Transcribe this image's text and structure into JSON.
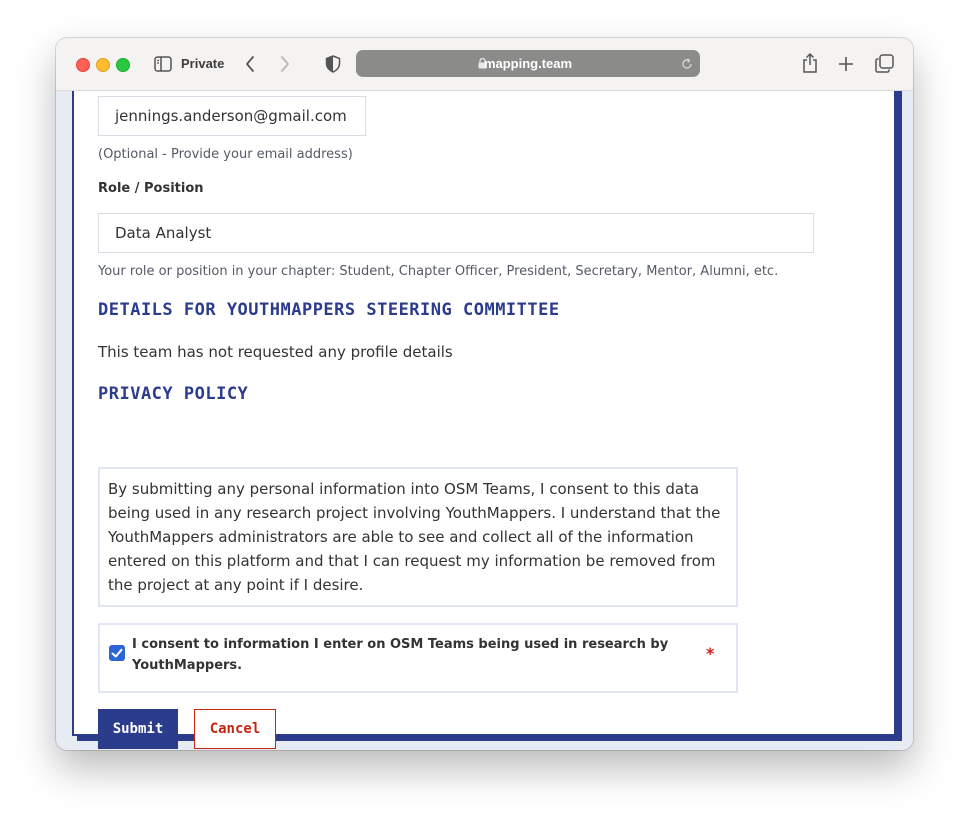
{
  "browser": {
    "mode_label": "Private",
    "url": "mapping.team"
  },
  "form": {
    "email_value": "jennings.anderson@gmail.com",
    "email_help": "(Optional - Provide your email address)",
    "role_label": "Role / Position",
    "role_value": "Data Analyst",
    "role_help": "Your role or position in your chapter: Student, Chapter Officer, President, Secretary, Mentor, Alumni, etc.",
    "details_title": "DETAILS FOR YOUTHMAPPERS STEERING COMMITTEE",
    "details_text": "This team has not requested any profile details",
    "privacy_title": "PRIVACY POLICY",
    "privacy_text": "By submitting any personal information into OSM Teams, I consent to this data being used in any research project involving YouthMappers. I understand that the YouthMappers administrators are able to see and collect all of the information entered on this platform and that I can request my information be removed from the project at any point if I desire.",
    "consent_label": "I consent to information I enter on OSM Teams being used in research by YouthMappers.",
    "consent_checked": true,
    "required_marker": "*",
    "submit_label": "Submit",
    "cancel_label": "Cancel"
  },
  "colors": {
    "accent": "#2c3c8c",
    "cancel": "#c42410",
    "checkbox": "#2a66d8",
    "required": "#d21f1f"
  }
}
